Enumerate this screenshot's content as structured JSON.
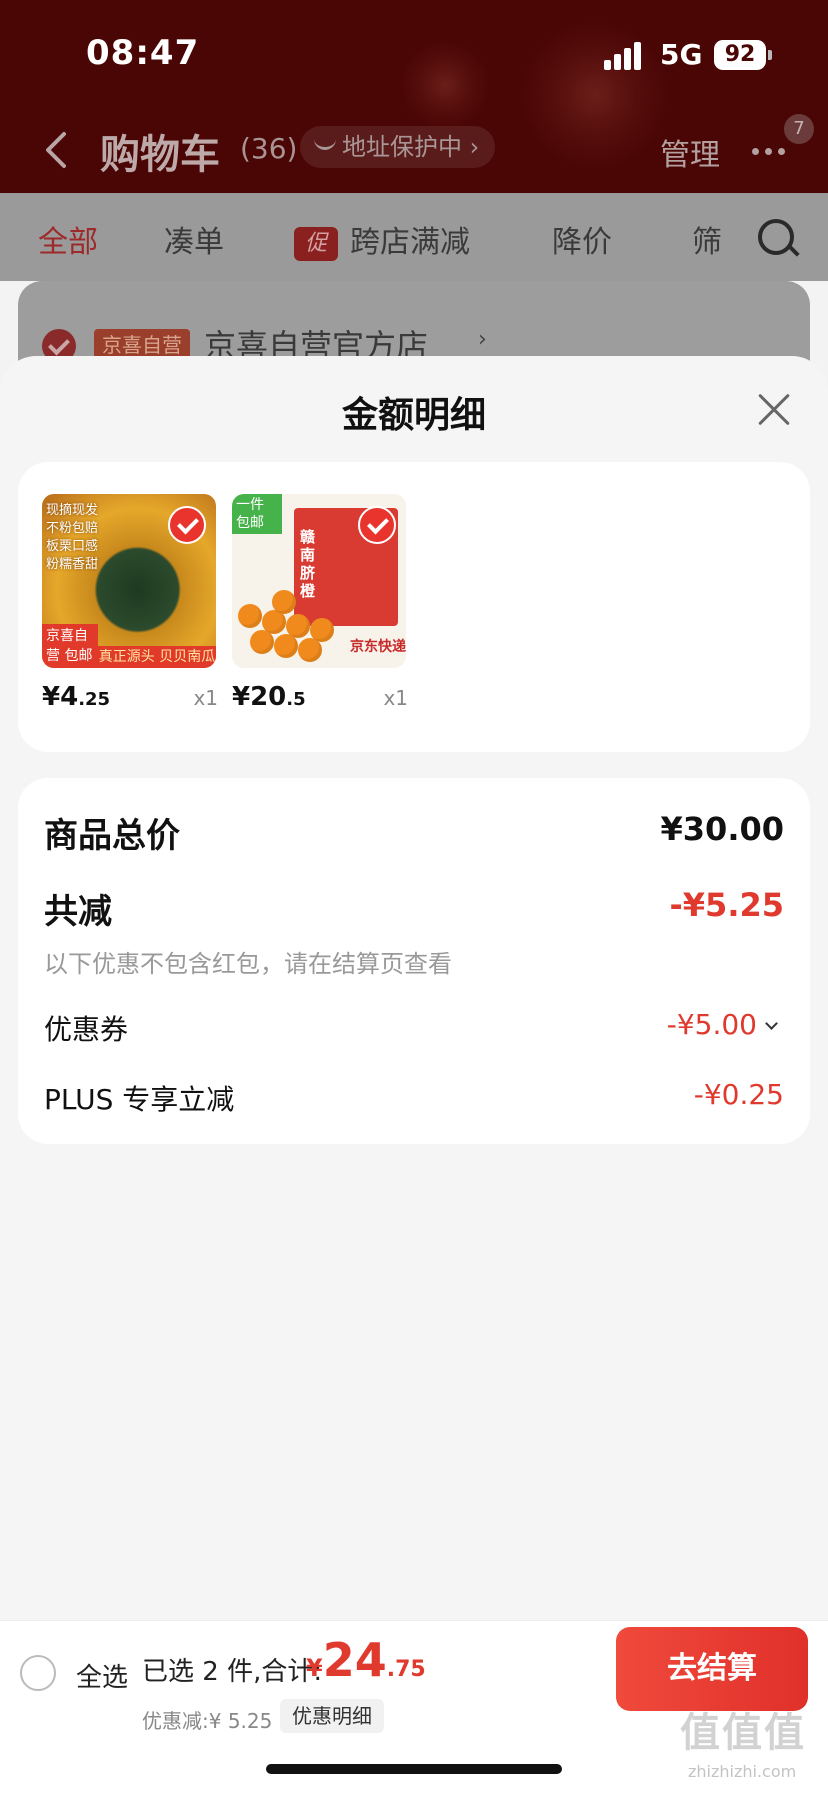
{
  "status_bar": {
    "time": "08:47",
    "network": "5G",
    "battery": "92"
  },
  "nav": {
    "title": "购物车",
    "count": "(36)",
    "address_protection": "地址保护中 ›",
    "manage": "管理",
    "more_badge": "7"
  },
  "tabs": {
    "all": "全部",
    "bundle": "凑单",
    "promo_badge": "促",
    "cross_store": "跨店满减",
    "price_drop": "降价",
    "filter": "筛"
  },
  "store": {
    "tag": "京喜自营",
    "name": "京喜自营官方店",
    "chevron": "›"
  },
  "sheet": {
    "title": "金额明细",
    "products": [
      {
        "price_main": "¥4",
        "price_decimal": ".25",
        "qty": "x1",
        "img_text_top": "现摘现发\n不粉包赔\n板栗口感\n粉糯香甜",
        "img_label_left": "京喜自营 包邮",
        "img_label_bar": "真正源头 贝贝南瓜"
      },
      {
        "price_main": "¥20",
        "price_decimal": ".5",
        "qty": "x1",
        "img_pill": "一件 包邮",
        "img_box_text": "赣南脐橙",
        "img_express": "京东快递"
      }
    ],
    "summary": {
      "goods_total_label": "商品总价",
      "goods_total_value": "¥30.00",
      "total_reduce_label": "共减",
      "total_reduce_value": "-¥5.25",
      "note": "以下优惠不包含红包，请在结算页查看",
      "coupon_label": "优惠券",
      "coupon_value": "-¥5.00",
      "plus_label": "PLUS 专享立减",
      "plus_value": "-¥0.25"
    }
  },
  "bottom_bar": {
    "select_all": "全选",
    "selected": "已选 2 件,合计:",
    "currency": "¥",
    "total_int": "24",
    "total_dec": ".75",
    "discount": "优惠减:¥ 5.25",
    "detail": "优惠明细",
    "checkout": "去结算"
  },
  "watermark": {
    "text": "值值值",
    "url": "zhizhizhi.com"
  },
  "colors": {
    "accent_red": "#e03a2e",
    "header_bg": "#4a0605",
    "sheet_bg": "#f5f5f5"
  }
}
